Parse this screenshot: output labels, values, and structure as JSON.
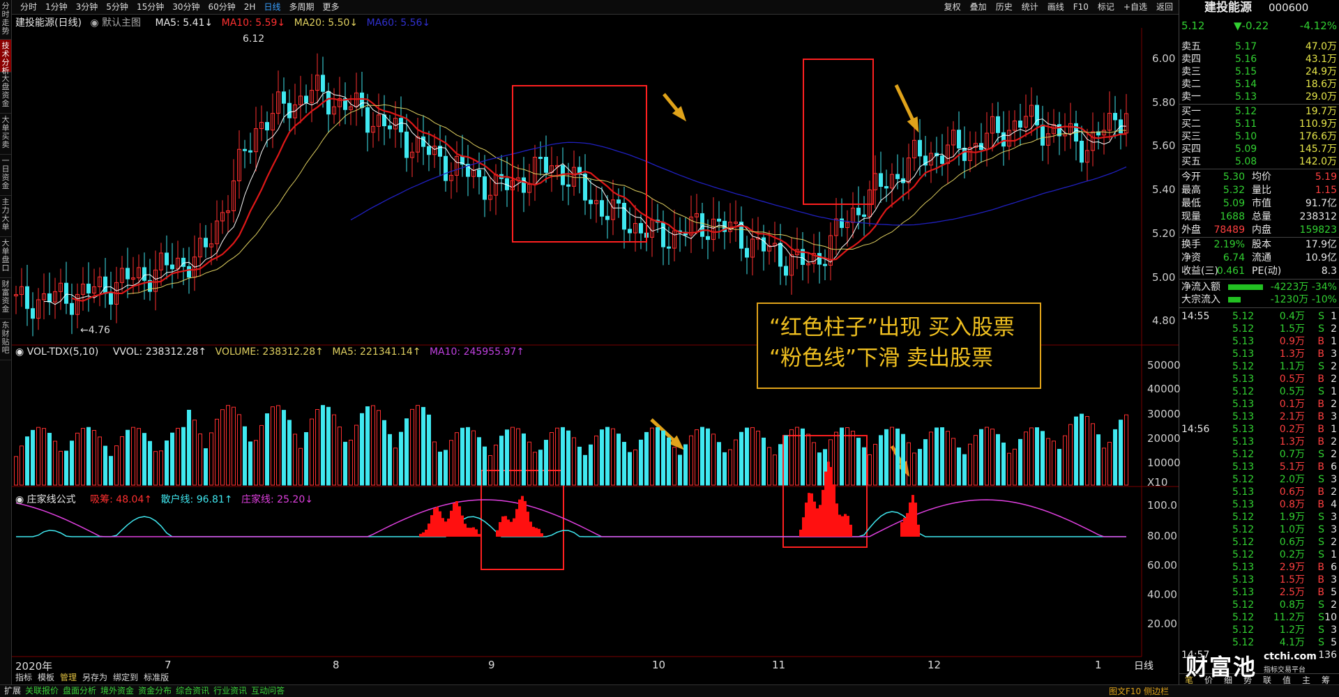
{
  "left_tabs": [
    "分时走势",
    "技术分析",
    "大盘资金",
    "大单买卖",
    "一日资金",
    "主力大单",
    "大单盘口",
    "财富资金",
    "东财贴吧"
  ],
  "periods": [
    "分时",
    "1分钟",
    "3分钟",
    "5分钟",
    "15分钟",
    "30分钟",
    "60分钟",
    "2H",
    "日线",
    "多周期",
    "更多"
  ],
  "tools": [
    "复权",
    "叠加",
    "历史",
    "统计",
    "画线",
    "F10",
    "标记",
    "+自选",
    "返回"
  ],
  "main_header": {
    "name": "建投能源(日线)",
    "indicator": "默认主图",
    "ma5": "MA5: 5.41↓",
    "ma10": "MA10: 5.59↓",
    "ma20": "MA20: 5.50↓",
    "ma60": "MA60: 5.56↓"
  },
  "price_axis": [
    "6.00",
    "5.80",
    "5.60",
    "5.40",
    "5.20",
    "5.00",
    "4.80"
  ],
  "high_label": "6.12",
  "low_label": "←4.76",
  "vol_header": {
    "name": "VOL-TDX(5,10)",
    "vvol": "VVOL: 238312.28↑",
    "volume": "VOLUME: 238312.28↑",
    "ma5": "MA5: 221341.14↑",
    "ma10": "MA10: 245955.97↑"
  },
  "vol_axis": [
    "50000",
    "40000",
    "30000",
    "20000",
    "10000",
    "X10"
  ],
  "ind_header": {
    "name": "庄家线公式",
    "xichou": "吸筹: 48.04↑",
    "sanhu": "散户线: 96.81↑",
    "zhuang": "庄家线: 25.20↓"
  },
  "ind_axis": [
    "100.0",
    "80.00",
    "60.00",
    "40.00",
    "20.00"
  ],
  "x_axis": [
    "2020年",
    "7",
    "8",
    "9",
    "10",
    "11",
    "12",
    "1"
  ],
  "sub_tabs": [
    "指标",
    "模板",
    "管理",
    "另存为",
    "绑定到",
    "标准版"
  ],
  "annotation": {
    "line1": "“红色柱子”出现 买入股票",
    "line2": "“粉色线”下滑  卖出股票"
  },
  "colors": {
    "up": "#ff3030",
    "down": "#40e8f0",
    "ma5": "#ffffff",
    "ma10": "#e01818",
    "ma20": "#e0d060",
    "ma60": "#2020c0",
    "pink": "#e040e0"
  },
  "right_panel": {
    "name": "建投能源",
    "code": "000600",
    "price": "5.12",
    "change": "▼-0.22",
    "pct": "-4.12%",
    "asks": [
      {
        "l": "卖五",
        "p": "5.17",
        "v": "47.0万"
      },
      {
        "l": "卖四",
        "p": "5.16",
        "v": "43.1万"
      },
      {
        "l": "卖三",
        "p": "5.15",
        "v": "24.9万"
      },
      {
        "l": "卖二",
        "p": "5.14",
        "v": "18.6万"
      },
      {
        "l": "卖一",
        "p": "5.13",
        "v": "29.0万"
      }
    ],
    "bids": [
      {
        "l": "买一",
        "p": "5.12",
        "v": "19.7万"
      },
      {
        "l": "买二",
        "p": "5.11",
        "v": "110.9万"
      },
      {
        "l": "买三",
        "p": "5.10",
        "v": "176.6万"
      },
      {
        "l": "买四",
        "p": "5.09",
        "v": "145.7万"
      },
      {
        "l": "买五",
        "p": "5.08",
        "v": "142.0万"
      }
    ],
    "stats": [
      {
        "a": "今开",
        "b": "5.30",
        "c": "均价",
        "d": "5.19"
      },
      {
        "a": "最高",
        "b": "5.32",
        "c": "量比",
        "d": "1.15"
      },
      {
        "a": "最低",
        "b": "5.09",
        "c": "市值",
        "d": "91.7亿"
      },
      {
        "a": "现量",
        "b": "1688",
        "c": "总量",
        "d": "238312"
      },
      {
        "a": "外盘",
        "b": "78489",
        "c": "内盘",
        "d": "159823"
      },
      {
        "a": "换手",
        "b": "2.19%",
        "c": "股本",
        "d": "17.9亿"
      },
      {
        "a": "净资",
        "b": "6.74",
        "c": "流通",
        "d": "10.9亿"
      },
      {
        "a": "收益(三)",
        "b": "0.461",
        "c": "PE(动)",
        "d": "8.3"
      }
    ],
    "flows": [
      {
        "l": "净流入额",
        "v": "-4223万 -34%"
      },
      {
        "l": "大宗流入",
        "v": "-1230万 -10%"
      }
    ],
    "ticks": [
      {
        "t": "14:55",
        "p": "5.12",
        "v": "0.4万",
        "s": "S",
        "n": "1"
      },
      {
        "t": "",
        "p": "5.12",
        "v": "1.5万",
        "s": "S",
        "n": "2"
      },
      {
        "t": "",
        "p": "5.13",
        "v": "0.9万",
        "s": "B",
        "n": "1"
      },
      {
        "t": "",
        "p": "5.13",
        "v": "1.3万",
        "s": "B",
        "n": "3"
      },
      {
        "t": "",
        "p": "5.12",
        "v": "1.1万",
        "s": "S",
        "n": "2"
      },
      {
        "t": "",
        "p": "5.13",
        "v": "0.5万",
        "s": "B",
        "n": "2"
      },
      {
        "t": "",
        "p": "5.12",
        "v": "0.5万",
        "s": "S",
        "n": "1"
      },
      {
        "t": "",
        "p": "5.13",
        "v": "0.1万",
        "s": "B",
        "n": "2"
      },
      {
        "t": "",
        "p": "5.13",
        "v": "2.1万",
        "s": "B",
        "n": "3"
      },
      {
        "t": "14:56",
        "p": "5.13",
        "v": "0.2万",
        "s": "B",
        "n": "1"
      },
      {
        "t": "",
        "p": "5.13",
        "v": "1.3万",
        "s": "B",
        "n": "2"
      },
      {
        "t": "",
        "p": "5.12",
        "v": "0.7万",
        "s": "S",
        "n": "2"
      },
      {
        "t": "",
        "p": "5.13",
        "v": "5.1万",
        "s": "B",
        "n": "6"
      },
      {
        "t": "",
        "p": "5.12",
        "v": "2.0万",
        "s": "S",
        "n": "3"
      },
      {
        "t": "",
        "p": "5.13",
        "v": "0.6万",
        "s": "B",
        "n": "2"
      },
      {
        "t": "",
        "p": "5.13",
        "v": "0.8万",
        "s": "B",
        "n": "4"
      },
      {
        "t": "",
        "p": "5.12",
        "v": "1.9万",
        "s": "S",
        "n": "3"
      },
      {
        "t": "",
        "p": "5.12",
        "v": "1.0万",
        "s": "S",
        "n": "3"
      },
      {
        "t": "",
        "p": "5.12",
        "v": "0.6万",
        "s": "S",
        "n": "2"
      },
      {
        "t": "",
        "p": "5.12",
        "v": "0.2万",
        "s": "S",
        "n": "1"
      },
      {
        "t": "",
        "p": "5.13",
        "v": "2.9万",
        "s": "B",
        "n": "6"
      },
      {
        "t": "",
        "p": "5.13",
        "v": "1.5万",
        "s": "B",
        "n": "3"
      },
      {
        "t": "",
        "p": "5.13",
        "v": "2.5万",
        "s": "B",
        "n": "5"
      },
      {
        "t": "",
        "p": "5.12",
        "v": "0.8万",
        "s": "S",
        "n": "2"
      },
      {
        "t": "",
        "p": "5.12",
        "v": "11.2万",
        "s": "S",
        "n": "10"
      },
      {
        "t": "",
        "p": "5.12",
        "v": "1.2万",
        "s": "S",
        "n": "3"
      },
      {
        "t": "",
        "p": "5.12",
        "v": "4.1万",
        "s": "S",
        "n": "5"
      }
    ],
    "last_tick": {
      "t": "14:57",
      "v": "136"
    },
    "date_label": "日线",
    "bottom_tabs": [
      "笔",
      "价",
      "细",
      "势",
      "联",
      "值",
      "主",
      "筹"
    ]
  },
  "bottom_bar": [
    "扩展",
    "关联报价",
    "盘面分析",
    "境外资金",
    "资金分布",
    "综合资讯",
    "行业资讯",
    "互动问答"
  ],
  "bottom_right": "图文F10 侧边栏",
  "watermark": {
    "main": "财富池",
    "site": "ctchi.com",
    "sub": "指标交易平台"
  }
}
